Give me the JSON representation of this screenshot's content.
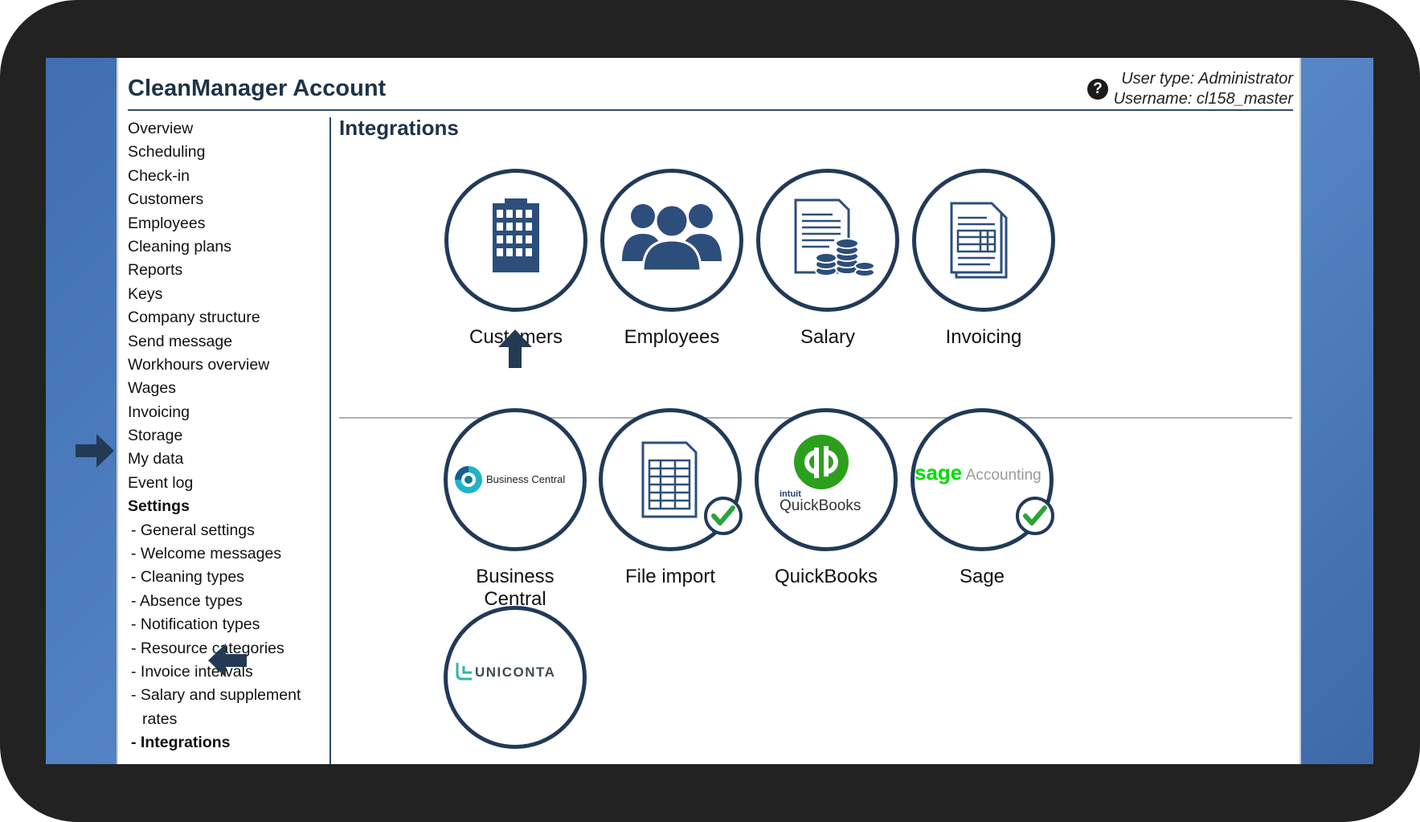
{
  "app": {
    "title": "CleanManager Account",
    "user_type": "User type: Administrator",
    "username": "Username: cl158_master"
  },
  "sidebar": {
    "items": [
      {
        "label": "Overview"
      },
      {
        "label": "Scheduling"
      },
      {
        "label": "Check-in"
      },
      {
        "label": "Customers"
      },
      {
        "label": "Employees"
      },
      {
        "label": "Cleaning plans"
      },
      {
        "label": "Reports"
      },
      {
        "label": "Keys"
      },
      {
        "label": "Company structure"
      },
      {
        "label": "Send message"
      },
      {
        "label": "Workhours overview"
      },
      {
        "label": "Wages"
      },
      {
        "label": "Invoicing"
      },
      {
        "label": "Storage"
      },
      {
        "label": "My data"
      },
      {
        "label": "Event log"
      },
      {
        "label": "Settings"
      },
      {
        "label": "- General settings"
      },
      {
        "label": "- Welcome messages"
      },
      {
        "label": "- Cleaning types"
      },
      {
        "label": "- Absence types"
      },
      {
        "label": "- Notification types"
      },
      {
        "label": "- Resource categories"
      },
      {
        "label": "- Invoice intervals"
      },
      {
        "label": "- Salary and supplement"
      },
      {
        "label": "rates"
      },
      {
        "label": "- Integrations"
      }
    ]
  },
  "main": {
    "title": "Integrations",
    "modules": [
      {
        "label": "Customers",
        "icon": "building-icon"
      },
      {
        "label": "Employees",
        "icon": "people-icon"
      },
      {
        "label": "Salary",
        "icon": "salary-document-coins-icon"
      },
      {
        "label": "Invoicing",
        "icon": "invoice-document-icon"
      }
    ],
    "integrations": [
      {
        "label_line1": "Business",
        "label_line2": "Central",
        "logo_text": "Business Central",
        "enabled": false
      },
      {
        "label_line1": "File import",
        "enabled": true
      },
      {
        "label_line1": "QuickBooks",
        "logo_small": "intuit",
        "logo_text": "QuickBooks",
        "enabled": false
      },
      {
        "label_line1": "Sage",
        "logo_brand": "sage",
        "logo_text": "Accounting",
        "enabled": true
      },
      {
        "logo_text": "UNICONTA",
        "enabled": false
      }
    ]
  },
  "colors": {
    "accent": "#2d4e7b",
    "border": "#213a58",
    "check": "#2aa33a",
    "qb_green": "#2ca01c",
    "sage_green": "#00dc06",
    "uniconta_teal": "#2fb4b0"
  }
}
